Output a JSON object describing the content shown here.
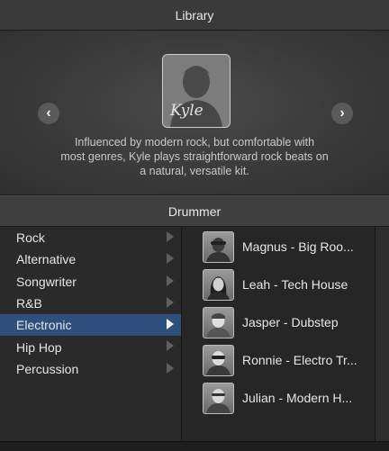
{
  "window": {
    "title": "Library"
  },
  "hero": {
    "portrait_label": "Kyle",
    "description_lines": [
      "Influenced by modern rock, but comfortable with",
      "most genres, Kyle plays straightforward rock beats on",
      "a natural, versatile kit."
    ]
  },
  "section": {
    "title": "Drummer"
  },
  "genres": [
    {
      "label": "Rock",
      "selected": false
    },
    {
      "label": "Alternative",
      "selected": false
    },
    {
      "label": "Songwriter",
      "selected": false
    },
    {
      "label": "R&B",
      "selected": false
    },
    {
      "label": "Electronic",
      "selected": true
    },
    {
      "label": "Hip Hop",
      "selected": false
    },
    {
      "label": "Percussion",
      "selected": false
    }
  ],
  "drummers": [
    {
      "label": "Magnus - Big Roo..."
    },
    {
      "label": "Leah - Tech House"
    },
    {
      "label": "Jasper - Dubstep"
    },
    {
      "label": "Ronnie - Electro Tr..."
    },
    {
      "label": "Julian - Modern H..."
    }
  ],
  "colors": {
    "selection": "#2f4f7c",
    "background": "#2b2b2b"
  }
}
